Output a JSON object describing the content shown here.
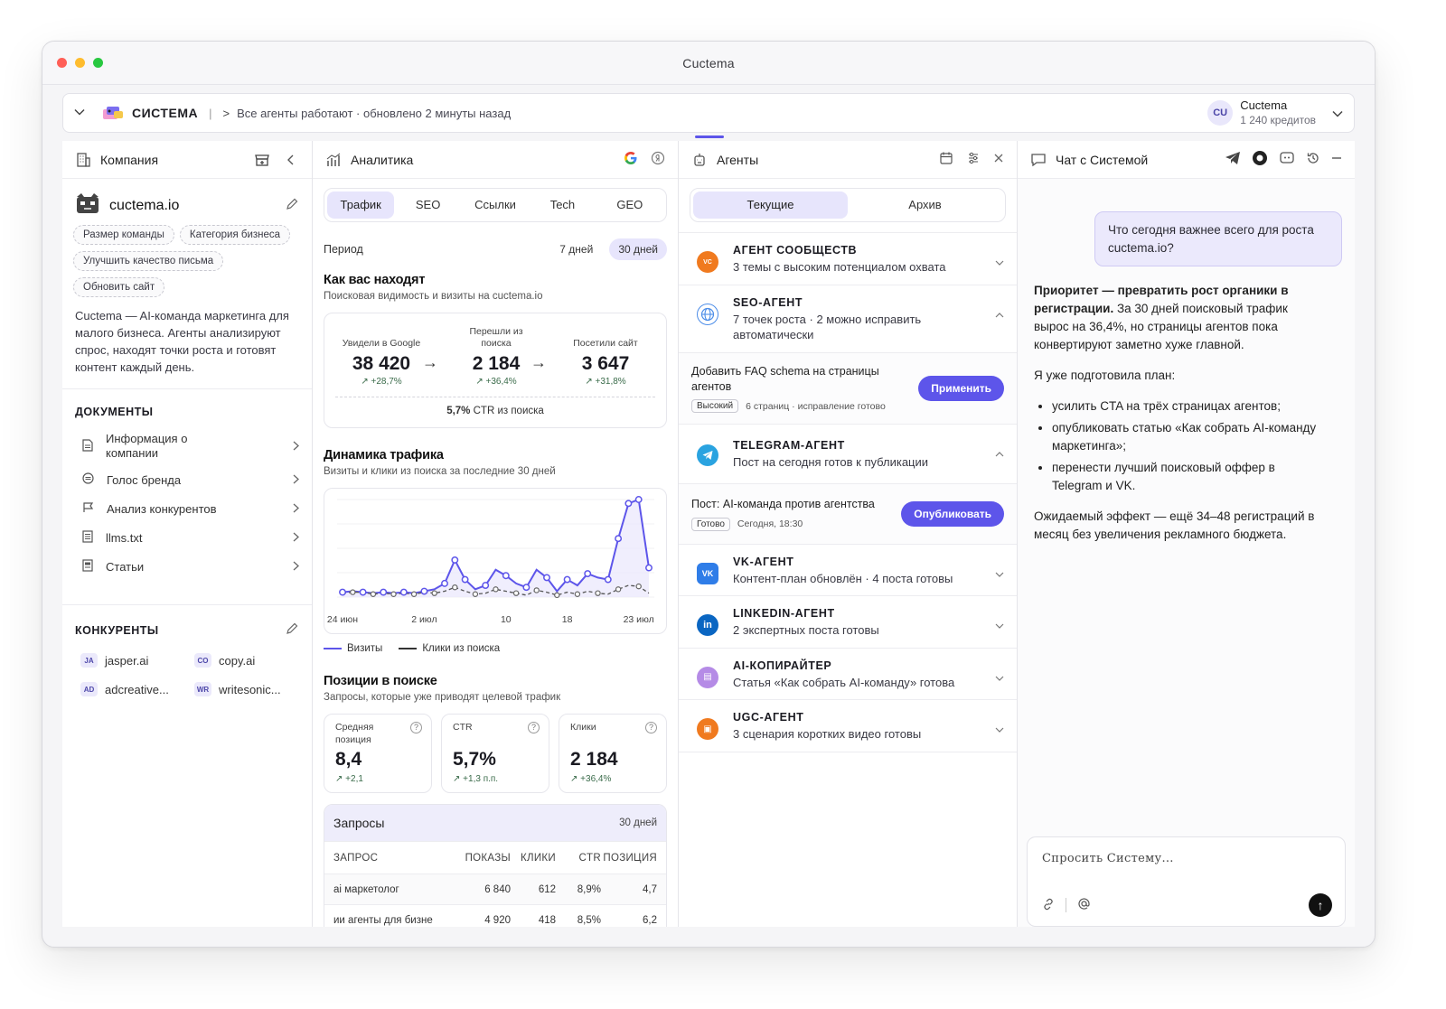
{
  "window": {
    "title": "Cuctema"
  },
  "topbar": {
    "brand": "СИСТЕМА",
    "separator": "|",
    "crumb_arrow": ">",
    "status": "Все агенты работают · обновлено 2 минуты назад",
    "account_initials": "CU",
    "account_name": "Cuctema",
    "account_credits": "1 240 кредитов"
  },
  "company": {
    "title": "Компания",
    "site": "cuctema.io",
    "tags": [
      "Размер команды",
      "Категория бизнеса",
      "Улучшить качество письма",
      "Обновить сайт"
    ],
    "description": "Cuctema — AI-команда маркетинга для малого бизнеса. Агенты анализируют спрос, находят точки роста и готовят контент каждый день.",
    "documents_title": "ДОКУМЕНТЫ",
    "documents": [
      "Информация о компании",
      "Голос бренда",
      "Анализ конкурентов",
      "llms.txt",
      "Статьи"
    ],
    "competitors_title": "КОНКУРЕНТЫ",
    "competitors": [
      {
        "code": "JA",
        "name": "jasper.ai"
      },
      {
        "code": "CO",
        "name": "copy.ai"
      },
      {
        "code": "AD",
        "name": "adcreative..."
      },
      {
        "code": "WR",
        "name": "writesonic..."
      }
    ]
  },
  "analytics": {
    "title": "Аналитика",
    "tabs": [
      "Трафик",
      "SEO",
      "Ссылки",
      "Tech",
      "GEO"
    ],
    "active_tab": 0,
    "period_label": "Период",
    "period_options": [
      "7 дней",
      "30 дней"
    ],
    "period_active": 1,
    "found_title": "Как вас находят",
    "found_sub": "Поисковая видимость и визиты на cuctema.io",
    "funnel": [
      {
        "label": "Увидели в Google",
        "value": "38 420",
        "delta": "+28,7%"
      },
      {
        "label": "Перешли из поиска",
        "value": "2 184",
        "delta": "+36,4%"
      },
      {
        "label": "Посетили сайт",
        "value": "3 647",
        "delta": "+31,8%"
      }
    ],
    "funnel_arrow": "→",
    "funnel_ctr_value": "5,7%",
    "funnel_ctr_text": "CTR из поиска",
    "dynamics_title": "Динамика трафика",
    "dynamics_sub": "Визиты и клики из поиска за последние 30 дней",
    "legend_visits": "Визиты",
    "legend_clicks": "Клики из поиска",
    "positions_title": "Позиции в поиске",
    "positions_sub": "Запросы, которые уже приводят целевой трафик",
    "kpis": [
      {
        "label": "Средняя позиция",
        "value": "8,4",
        "delta": "+2,1"
      },
      {
        "label": "CTR",
        "value": "5,7%",
        "delta": "+1,3 п.п."
      },
      {
        "label": "Клики",
        "value": "2 184",
        "delta": "+36,4%"
      }
    ],
    "queries": {
      "title": "Запросы",
      "period": "30 дней",
      "headers": [
        "ЗАПРОС",
        "ПОКАЗЫ",
        "КЛИКИ",
        "CTR",
        "ПОЗИЦИЯ"
      ],
      "rows": [
        [
          "ai маркетолог",
          "6 840",
          "612",
          "8,9%",
          "4,7"
        ],
        [
          "ии агенты для бизне",
          "4 920",
          "418",
          "8,5%",
          "6,2"
        ]
      ]
    }
  },
  "chart_data": {
    "type": "line",
    "title": "Динамика трафика",
    "x_ticks": [
      "24 июн",
      "2 июл",
      "10",
      "18",
      "23 июл"
    ],
    "x_tick_index": [
      0,
      8,
      16,
      22,
      29
    ],
    "ylim": [
      0,
      100
    ],
    "series": [
      {
        "name": "Визиты",
        "values": [
          5,
          6,
          5,
          4,
          5,
          4,
          5,
          4,
          6,
          8,
          14,
          38,
          18,
          8,
          12,
          28,
          22,
          14,
          10,
          28,
          20,
          6,
          18,
          12,
          24,
          20,
          18,
          60,
          96,
          100,
          30
        ]
      },
      {
        "name": "Клики из поиска",
        "values": [
          4,
          5,
          5,
          3,
          4,
          3,
          4,
          3,
          5,
          4,
          6,
          10,
          6,
          3,
          4,
          8,
          6,
          4,
          2,
          7,
          5,
          2,
          5,
          3,
          6,
          4,
          3,
          8,
          12,
          11,
          4
        ]
      }
    ],
    "grid": true,
    "legend": "bottom"
  },
  "agents": {
    "title": "Агенты",
    "tabs": [
      "Текущие",
      "Архив"
    ],
    "active_tab": 0,
    "items": [
      {
        "name": "АГЕНТ СООБЩЕСТВ",
        "desc": "3 темы с высоким потенциалом охвата",
        "color": "#f07a1f",
        "glyph": "VC",
        "open": false
      },
      {
        "name": "SEO-АГЕНТ",
        "desc": "7 точек роста · 2 можно исправить автоматически",
        "color": "#4c8de8",
        "glyph": "⊕",
        "open": true
      },
      {
        "name": "TELEGRAM-АГЕНТ",
        "desc": "Пост на сегодня готов к публикации",
        "color": "#2aa3e0",
        "glyph": "➤",
        "open": true
      },
      {
        "name": "VK-АГЕНТ",
        "desc": "Контент-план обновлён · 4 поста готовы",
        "color": "#2f7de8",
        "glyph": "VK",
        "open": false
      },
      {
        "name": "LINKEDIN-АГЕНТ",
        "desc": "2 экспертных поста готовы",
        "color": "#0a66c2",
        "glyph": "in",
        "open": false
      },
      {
        "name": "AI-КОПИРАЙТЕР",
        "desc": "Статья «Как собрать AI-команду» готова",
        "color": "#b58be6",
        "glyph": "▤",
        "open": false
      },
      {
        "name": "UGC-АГЕНТ",
        "desc": "3 сценария коротких видео готовы",
        "color": "#f07a1f",
        "glyph": "▣",
        "open": false
      }
    ],
    "seo_action": {
      "title": "Добавить FAQ schema на страницы агентов",
      "chip": "Высокий",
      "meta": "6 страниц · исправление готово",
      "button": "Применить"
    },
    "tg_action": {
      "title": "Пост: AI-команда против агентства",
      "chip": "Готово",
      "meta": "Сегодня, 18:30",
      "button": "Опубликовать"
    }
  },
  "chat": {
    "title": "Чат с Системой",
    "user_message": "Что сегодня важнее всего для роста cuctema.io?",
    "bot_bold": "Приоритет — превратить рост органики в регистрации.",
    "bot_rest": " За 30 дней поисковый трафик вырос на 36,4%, но страницы агентов пока конвертируют заметно хуже главной.",
    "bot_plan_intro": "Я уже подготовила план:",
    "bot_plan": [
      "усилить CTA на трёх страницах агентов;",
      "опубликовать статью «Как собрать AI-команду маркетинга»;",
      "перенести лучший поисковый оффер в Telegram и VK."
    ],
    "bot_effect": "Ожидаемый эффект — ещё 34–48 регистраций в месяц без увеличения рекламного бюджета.",
    "input_placeholder": "Спросить Систему...",
    "send_glyph": "↑"
  },
  "colors": {
    "accent": "#5d55ea",
    "accent_soft": "#e7e5fc",
    "success": "#3a6b4a"
  }
}
